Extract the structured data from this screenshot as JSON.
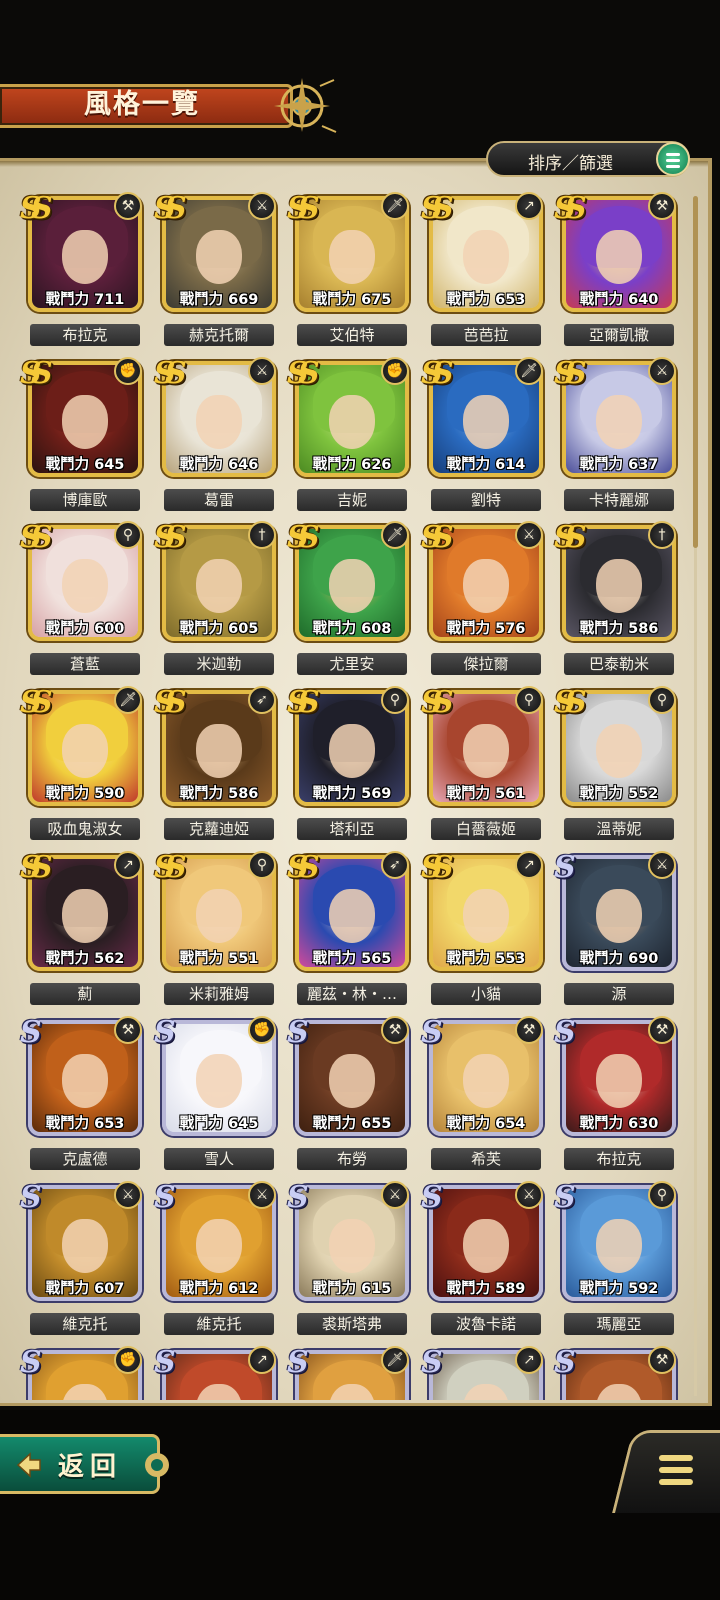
{
  "header": {
    "title": "風格一覽"
  },
  "toolbar": {
    "sort_filter_label": "排序／篩選"
  },
  "footer": {
    "back_label": "返回"
  },
  "power_prefix": "戰鬥力",
  "characters": [
    {
      "name": "布拉克",
      "power": 711,
      "rank": "SS",
      "weapon": "axe",
      "palette": [
        "#5a1f3a",
        "#2a1420",
        "#8b2d4a"
      ]
    },
    {
      "name": "赫克托爾",
      "power": 669,
      "rank": "SS",
      "weapon": "sword",
      "palette": [
        "#7a6a48",
        "#3b3a32",
        "#b4a07a"
      ]
    },
    {
      "name": "艾伯特",
      "power": 675,
      "rank": "SS",
      "weapon": "rapier",
      "palette": [
        "#d9b653",
        "#a67f2e",
        "#f0d58b"
      ]
    },
    {
      "name": "芭芭拉",
      "power": 653,
      "rank": "SS",
      "weapon": "spear",
      "palette": [
        "#f1e7c9",
        "#d0b46a",
        "#f7f0de"
      ]
    },
    {
      "name": "亞爾凱撒",
      "power": 640,
      "rank": "SS",
      "weapon": "axe",
      "palette": [
        "#7a3fc8",
        "#c73a54",
        "#f0d06a"
      ]
    },
    {
      "name": "博庫歐",
      "power": 645,
      "rank": "SS",
      "weapon": "fist",
      "palette": [
        "#6c1e18",
        "#2b1310",
        "#b43a2a"
      ]
    },
    {
      "name": "葛雷",
      "power": 646,
      "rank": "SS",
      "weapon": "sword",
      "palette": [
        "#e9e4d6",
        "#b7a37c",
        "#f2efe6"
      ]
    },
    {
      "name": "吉妮",
      "power": 626,
      "rank": "SS",
      "weapon": "fist",
      "palette": [
        "#7fc33e",
        "#4c8a22",
        "#cfe88e"
      ]
    },
    {
      "name": "劉特",
      "power": 614,
      "rank": "SS",
      "weapon": "rapier",
      "palette": [
        "#2a6bc0",
        "#173e7a",
        "#7eb2e8"
      ]
    },
    {
      "name": "卡特麗娜",
      "power": 637,
      "rank": "SS",
      "weapon": "sword",
      "palette": [
        "#c7c9e6",
        "#4c4f9a",
        "#e5e1ef"
      ]
    },
    {
      "name": "蒼藍",
      "power": 600,
      "rank": "SS",
      "weapon": "staff",
      "palette": [
        "#f0e0dc",
        "#d7a1a4",
        "#f7eeea"
      ]
    },
    {
      "name": "米迦勒",
      "power": 605,
      "rank": "SS",
      "weapon": "dagger",
      "palette": [
        "#b59a45",
        "#7d6b2a",
        "#d8c57a"
      ]
    },
    {
      "name": "尤里安",
      "power": 608,
      "rank": "SS",
      "weapon": "rapier",
      "palette": [
        "#3ea34a",
        "#1f6b2a",
        "#e9b55a"
      ]
    },
    {
      "name": "傑拉爾",
      "power": 576,
      "rank": "SS",
      "weapon": "sword",
      "palette": [
        "#e07a2a",
        "#a4431a",
        "#f4c06a"
      ]
    },
    {
      "name": "巴泰勒米",
      "power": 586,
      "rank": "SS",
      "weapon": "dagger",
      "palette": [
        "#2b2b30",
        "#5a5664",
        "#c9c5b8"
      ]
    },
    {
      "name": "吸血鬼淑女",
      "power": 590,
      "rank": "SS",
      "weapon": "rapier",
      "palette": [
        "#f1cf3d",
        "#c0392b",
        "#fbe69a"
      ]
    },
    {
      "name": "克蘿迪婭",
      "power": 586,
      "rank": "SS",
      "weapon": "bow",
      "palette": [
        "#5a3a1a",
        "#8a5a2a",
        "#d8b27a"
      ]
    },
    {
      "name": "塔利亞",
      "power": 569,
      "rank": "SS",
      "weapon": "staff",
      "palette": [
        "#1f1f2a",
        "#3a3f6a",
        "#e0d2b4"
      ]
    },
    {
      "name": "白薔薇姬",
      "power": 561,
      "rank": "SS",
      "weapon": "staff",
      "palette": [
        "#a8452e",
        "#e6a7b6",
        "#f6e2d2"
      ]
    },
    {
      "name": "溫蒂妮",
      "power": 552,
      "rank": "SS",
      "weapon": "staff",
      "palette": [
        "#d8d8d8",
        "#8a8a8a",
        "#f0ece2"
      ]
    },
    {
      "name": "薊",
      "power": 562,
      "rank": "SS",
      "weapon": "spear",
      "palette": [
        "#2a1e22",
        "#6a2a4a",
        "#e0cfb9"
      ]
    },
    {
      "name": "米莉雅姆",
      "power": 551,
      "rank": "SS",
      "weapon": "staff",
      "palette": [
        "#f0c87a",
        "#d2994a",
        "#fae7bc"
      ]
    },
    {
      "name": "麗茲・林・…",
      "power": 565,
      "rank": "SS",
      "weapon": "bow",
      "palette": [
        "#2a4ab0",
        "#d24a9a",
        "#f2e0d0"
      ]
    },
    {
      "name": "小貓",
      "power": 553,
      "rank": "SS",
      "weapon": "spear",
      "palette": [
        "#f2d86a",
        "#e0a84a",
        "#fbf0c0"
      ]
    },
    {
      "name": "源",
      "power": 690,
      "rank": "S",
      "weapon": "sword",
      "palette": [
        "#3a4a5a",
        "#1e2530",
        "#b48a6a"
      ]
    },
    {
      "name": "克盧德",
      "power": 653,
      "rank": "S",
      "weapon": "axe",
      "palette": [
        "#c0601a",
        "#5a2a0a",
        "#e0a040"
      ]
    },
    {
      "name": "雪人",
      "power": 645,
      "rank": "S",
      "weapon": "fist",
      "palette": [
        "#f7f7fb",
        "#d8dbe8",
        "#ffffff"
      ]
    },
    {
      "name": "布勞",
      "power": 655,
      "rank": "S",
      "weapon": "axe",
      "palette": [
        "#6a3a22",
        "#3e2010",
        "#a0603a"
      ]
    },
    {
      "name": "希芙",
      "power": 654,
      "rank": "S",
      "weapon": "axe",
      "palette": [
        "#e8c06a",
        "#b5843a",
        "#f4dcaa"
      ]
    },
    {
      "name": "布拉克",
      "power": 630,
      "rank": "S",
      "weapon": "axe",
      "palette": [
        "#b02a2a",
        "#3a1a1a",
        "#e8d8c8"
      ]
    },
    {
      "name": "維克托",
      "power": 607,
      "rank": "S",
      "weapon": "sword",
      "palette": [
        "#c08a2a",
        "#6a4a12",
        "#f0c860"
      ]
    },
    {
      "name": "維克托",
      "power": 612,
      "rank": "S",
      "weapon": "sword",
      "palette": [
        "#e0a030",
        "#a05a12",
        "#f6d070"
      ]
    },
    {
      "name": "裘斯塔弗",
      "power": 615,
      "rank": "S",
      "weapon": "sword",
      "palette": [
        "#e0d2b0",
        "#8a7a5a",
        "#f4ecd8"
      ]
    },
    {
      "name": "波魯卡諾",
      "power": 589,
      "rank": "S",
      "weapon": "sword",
      "palette": [
        "#8a2a1a",
        "#4a1010",
        "#c05a3a"
      ]
    },
    {
      "name": "瑪麗亞",
      "power": 592,
      "rank": "S",
      "weapon": "staff",
      "palette": [
        "#5a9ad8",
        "#2a5a9a",
        "#cfe0f2"
      ]
    },
    {
      "name": "",
      "power": null,
      "rank": "S",
      "weapon": "fist",
      "palette": [
        "#e0a030",
        "#8a5a1a",
        "#f4d080"
      ]
    },
    {
      "name": "",
      "power": null,
      "rank": "S",
      "weapon": "spear",
      "palette": [
        "#c04a2a",
        "#5a2a1a",
        "#e08a5a"
      ]
    },
    {
      "name": "",
      "power": null,
      "rank": "S",
      "weapon": "rapier",
      "palette": [
        "#e0a040",
        "#7a4a1a",
        "#f0d090"
      ]
    },
    {
      "name": "",
      "power": null,
      "rank": "S",
      "weapon": "spear",
      "palette": [
        "#d0d0c0",
        "#6a5a4a",
        "#f0ece0"
      ]
    },
    {
      "name": "",
      "power": null,
      "rank": "S",
      "weapon": "axe",
      "palette": [
        "#b05a2a",
        "#5a2a12",
        "#e0a060"
      ]
    }
  ],
  "colors": {
    "ss_frame": "#e3bb45",
    "s_frame": "#b9b8d8",
    "panel_bg": "#e8dfc6",
    "accent_green": "#138a6c",
    "title_red": "#c2461e"
  }
}
